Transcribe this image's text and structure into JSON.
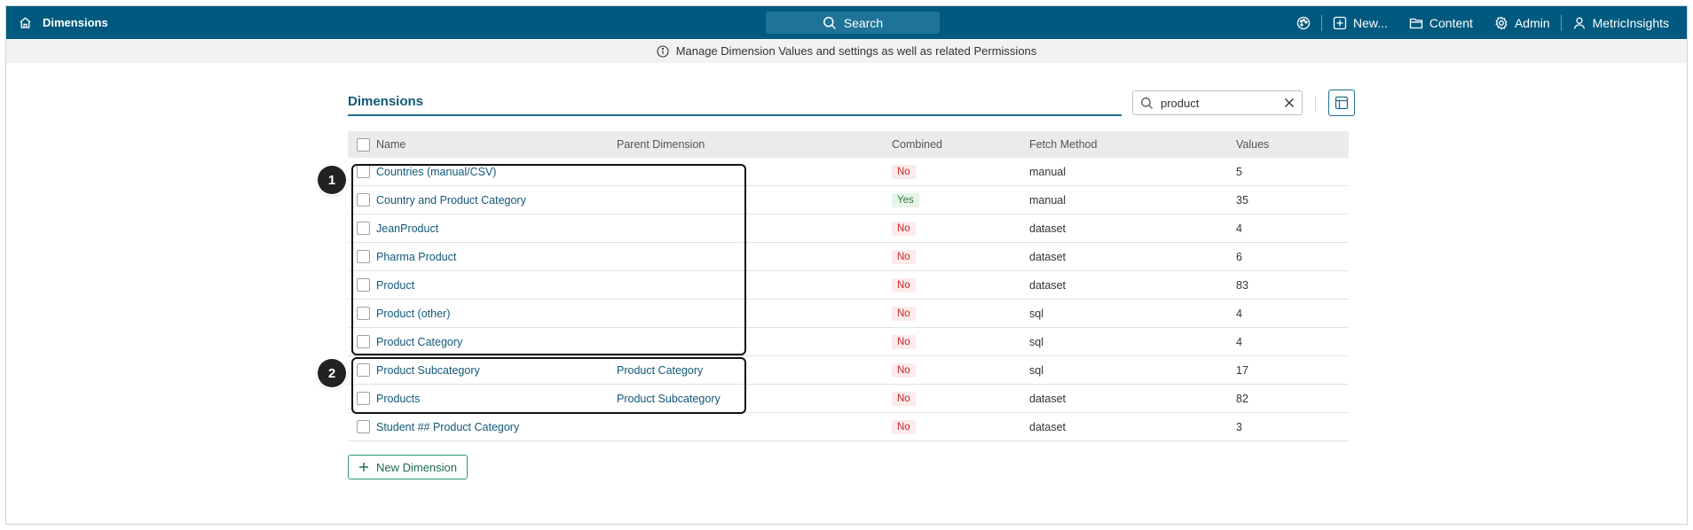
{
  "topbar": {
    "title": "Dimensions",
    "search_label": "Search",
    "new_label": "New...",
    "content_label": "Content",
    "admin_label": "Admin",
    "user_label": "MetricInsights",
    "bg_color": "#005a7f"
  },
  "infobar": {
    "text": "Manage Dimension Values and settings as well as related Permissions"
  },
  "header": {
    "tab_label": "Dimensions",
    "search_value": "product"
  },
  "table": {
    "columns": [
      "Name",
      "Parent Dimension",
      "Combined",
      "Fetch Method",
      "Values"
    ],
    "rows": [
      {
        "name": "Countries (manual/CSV)",
        "parent": "",
        "combined": "No",
        "fetch": "manual",
        "values": "5"
      },
      {
        "name": "Country and Product Category",
        "parent": "",
        "combined": "Yes",
        "fetch": "manual",
        "values": "35"
      },
      {
        "name": "JeanProduct",
        "parent": "",
        "combined": "No",
        "fetch": "dataset",
        "values": "4"
      },
      {
        "name": "Pharma Product",
        "parent": "",
        "combined": "No",
        "fetch": "dataset",
        "values": "6"
      },
      {
        "name": "Product",
        "parent": "",
        "combined": "No",
        "fetch": "dataset",
        "values": "83"
      },
      {
        "name": "Product (other)",
        "parent": "",
        "combined": "No",
        "fetch": "sql",
        "values": "4"
      },
      {
        "name": "Product Category",
        "parent": "",
        "combined": "No",
        "fetch": "sql",
        "values": "4"
      },
      {
        "name": "Product Subcategory",
        "parent": "Product Category",
        "combined": "No",
        "fetch": "sql",
        "values": "17"
      },
      {
        "name": "Products",
        "parent": "Product Subcategory",
        "combined": "No",
        "fetch": "dataset",
        "values": "82"
      },
      {
        "name": "Student ## Product Category",
        "parent": "",
        "combined": "No",
        "fetch": "dataset",
        "values": "3"
      }
    ]
  },
  "new_dimension_label": "New Dimension",
  "callouts": [
    "1",
    "2"
  ]
}
